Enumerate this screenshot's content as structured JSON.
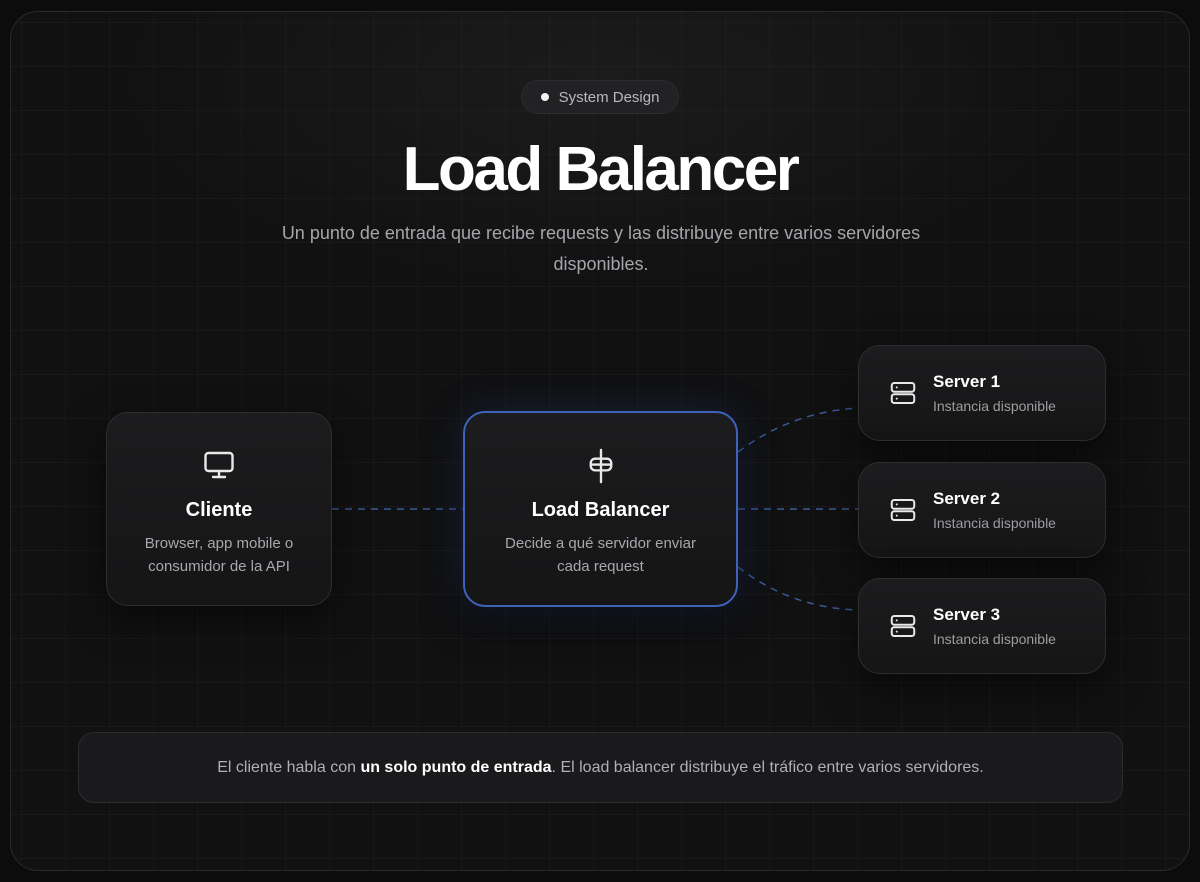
{
  "badge": {
    "label": "System Design"
  },
  "header": {
    "title": "Load Balancer",
    "subtitle": "Un punto de entrada que recibe requests y las distribuye entre varios servidores disponibles."
  },
  "nodes": {
    "client": {
      "title": "Cliente",
      "desc": "Browser, app mobile o consumidor de la API",
      "icon": "monitor-icon"
    },
    "balancer": {
      "title": "Load Balancer",
      "desc": "Decide a qué servidor enviar cada request",
      "icon": "balancer-icon"
    },
    "servers": [
      {
        "title": "Server 1",
        "desc": "Instancia disponible",
        "icon": "server-icon"
      },
      {
        "title": "Server 2",
        "desc": "Instancia disponible",
        "icon": "server-icon"
      },
      {
        "title": "Server 3",
        "desc": "Instancia disponible",
        "icon": "server-icon"
      }
    ]
  },
  "footer": {
    "before": "El cliente habla con ",
    "highlight": "un solo punto de entrada",
    "after": ". El load balancer distribuye el tráfico entre varios servidores."
  },
  "colors": {
    "accent": "#3e63b8",
    "link": "#3b5a9a",
    "background": "#111112"
  }
}
